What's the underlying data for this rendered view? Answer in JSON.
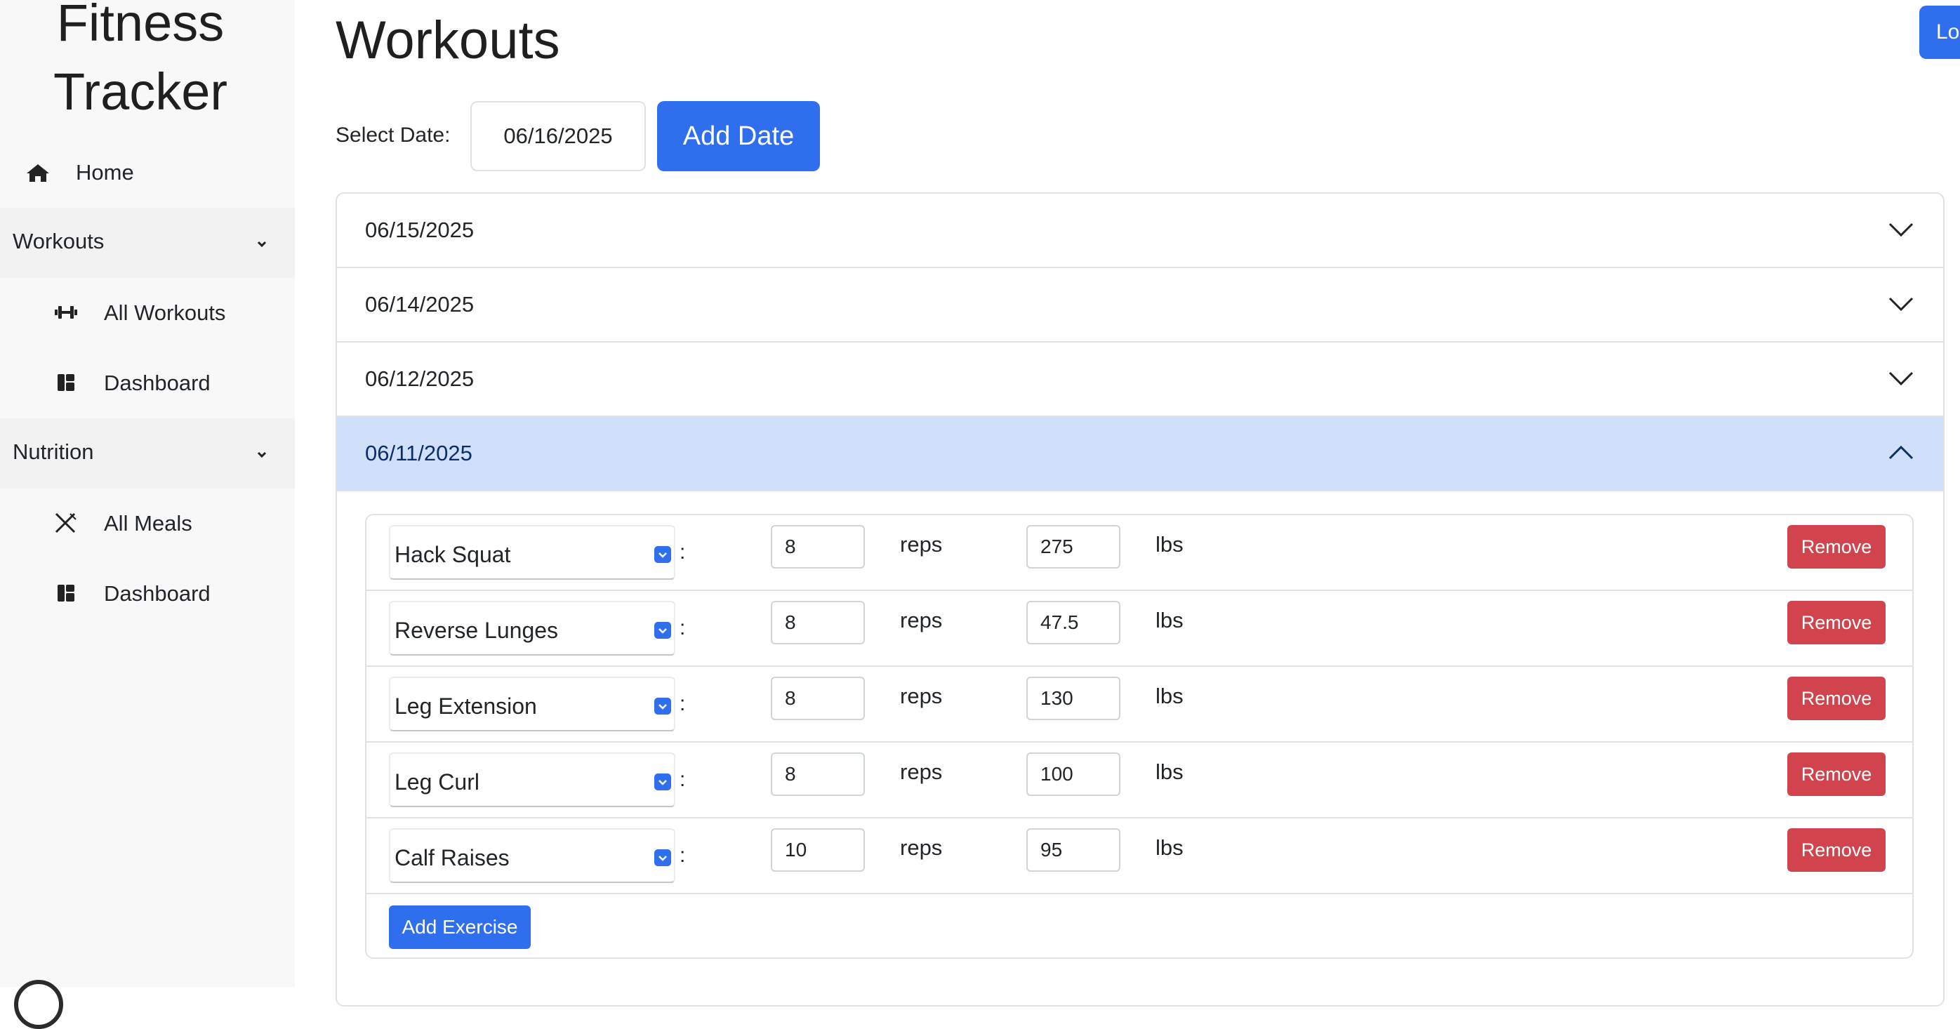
{
  "sidebar": {
    "brand_line1": "Fitness",
    "brand_line2": "Tracker",
    "home_label": "Home",
    "workouts_group": "Workouts",
    "workouts_items": [
      "All Workouts",
      "Dashboard"
    ],
    "nutrition_group": "Nutrition",
    "nutrition_items": [
      "All Meals",
      "Dashboard"
    ]
  },
  "header": {
    "title": "Workouts",
    "login_label": "Lo"
  },
  "date_picker": {
    "label": "Select Date:",
    "value": "06/16/2025",
    "add_label": "Add Date"
  },
  "accordion": {
    "dates": [
      "06/15/2025",
      "06/14/2025",
      "06/12/2025",
      "06/11/2025"
    ],
    "open_index": 3
  },
  "exercises": [
    {
      "name": "Hack Squat",
      "reps": "8",
      "weight": "275"
    },
    {
      "name": "Reverse Lunges",
      "reps": "8",
      "weight": "47.5"
    },
    {
      "name": "Leg Extension",
      "reps": "8",
      "weight": "130"
    },
    {
      "name": "Leg Curl",
      "reps": "8",
      "weight": "100"
    },
    {
      "name": "Calf Raises",
      "reps": "10",
      "weight": "95"
    }
  ],
  "labels": {
    "colon": ":",
    "reps_unit": "reps",
    "weight_unit": "lbs",
    "remove_label": "Remove",
    "add_exercise_label": "Add Exercise"
  },
  "colors": {
    "primary": "#2f6fee",
    "danger": "#d1444d",
    "open_header": "#d0e0fa",
    "sidebar_bg": "#f8f8f8"
  }
}
